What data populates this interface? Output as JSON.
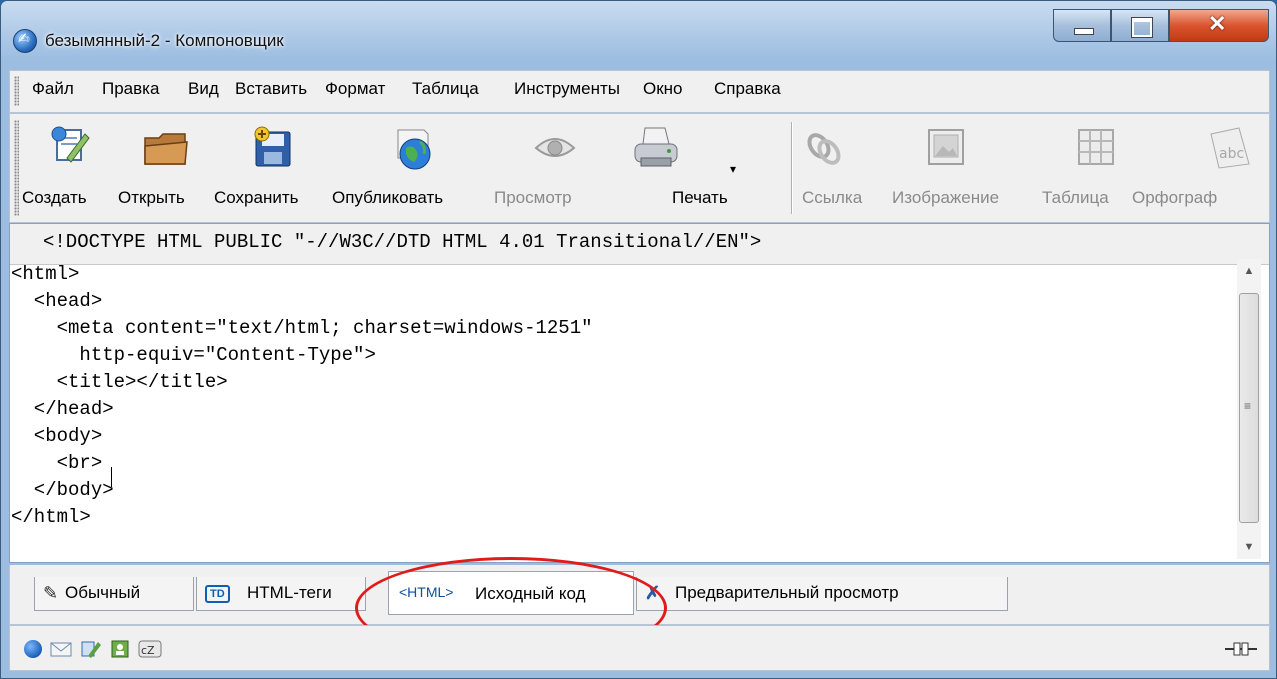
{
  "window": {
    "title": "безымянный-2 - Компоновщик",
    "app_icon": "composer-app-icon",
    "controls": [
      "minimize-icon",
      "maximize-icon",
      "close-icon"
    ]
  },
  "menu": [
    {
      "label": "Файл"
    },
    {
      "label": "Правка"
    },
    {
      "label": "Вид"
    },
    {
      "label": "Вставить"
    },
    {
      "label": "Формат"
    },
    {
      "label": "Таблица"
    },
    {
      "label": "Инструменты"
    },
    {
      "label": "Окно"
    },
    {
      "label": "Справка"
    }
  ],
  "toolbar": [
    {
      "label": "Создать",
      "icon": "new-document-icon",
      "enabled": true
    },
    {
      "label": "Открыть",
      "icon": "folder-icon",
      "enabled": true
    },
    {
      "label": "Сохранить",
      "icon": "save-disk-icon",
      "enabled": true
    },
    {
      "label": "Опубликовать",
      "icon": "globe-publish-icon",
      "enabled": true
    },
    {
      "label": "Просмотр",
      "icon": "eye-icon",
      "enabled": false
    },
    {
      "label": "Печать",
      "icon": "printer-icon",
      "enabled": true
    },
    {
      "label": "Ссылка",
      "icon": "link-chain-icon",
      "enabled": false
    },
    {
      "label": "Изображение",
      "icon": "image-icon",
      "enabled": false
    },
    {
      "label": "Таблица",
      "icon": "table-icon",
      "enabled": false
    },
    {
      "label": "Орфограф",
      "icon": "spellcheck-icon",
      "enabled": false
    }
  ],
  "editor": {
    "doctype": "<!DOCTYPE HTML PUBLIC \"-//W3C//DTD HTML 4.01 Transitional//EN\">",
    "lines": [
      "<html>",
      "  <head>",
      "    <meta content=\"text/html; charset=windows-1251\"",
      "      http-equiv=\"Content-Type\">",
      "    <title></title>",
      "  </head>",
      "  <body>",
      "    <br>",
      "  </body>",
      "</html>"
    ]
  },
  "tabs": [
    {
      "label": "Обычный",
      "icon": "pen-icon",
      "active": false
    },
    {
      "label": "HTML-теги",
      "icon": "td-tag-icon",
      "active": false
    },
    {
      "label": "Исходный код",
      "icon_text": "<HTML>",
      "active": true
    },
    {
      "label": "Предварительный просмотр",
      "icon": "preview-glasses-icon",
      "active": false
    }
  ],
  "statusbar": {
    "icons": [
      "globe-icon",
      "mail-icon",
      "composer-icon",
      "address-book-icon",
      "chatzilla-icon",
      "connection-plug-icon"
    ]
  },
  "colors": {
    "highlight_ellipse": "#e01b1b",
    "titlebar": "#a9c6e6",
    "close_button": "#d9552f"
  }
}
